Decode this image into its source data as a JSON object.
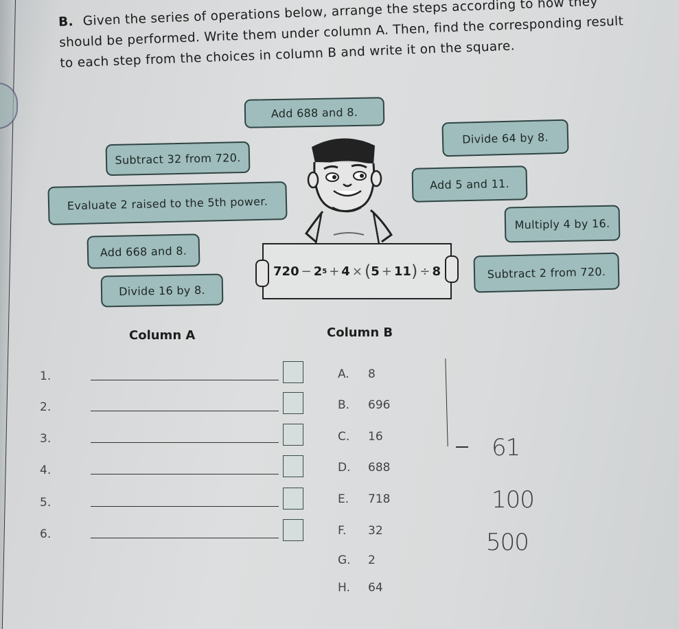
{
  "instructions": {
    "label": "B.",
    "text": "Given the series of operations below, arrange the steps according to how they should be performed. Write them under column A. Then, find the corresponding result to each step from the choices in column B and write it on the square."
  },
  "steps": [
    "Add 688 and 8.",
    "Subtract 32 from 720.",
    "Divide 64 by 8.",
    "Evaluate 2 raised to the 5th power.",
    "Add 5 and 11.",
    "Multiply 4 by 16.",
    "Add 668 and 8.",
    "Divide 16 by 8.",
    "Subtract 2 from 720."
  ],
  "expression": {
    "base1": "720",
    "minus": "−",
    "base2": "2",
    "exp": "5",
    "plus1": "+",
    "factor": "4",
    "times": "×",
    "open": "(",
    "a": "5",
    "plus2": "+",
    "b": "11",
    "close": ")",
    "div": "÷",
    "divisor": "8"
  },
  "column_a": {
    "title": "Column A",
    "rows": [
      "1.",
      "2.",
      "3.",
      "4.",
      "5.",
      "6."
    ]
  },
  "column_b": {
    "title": "Column B",
    "items": [
      {
        "letter": "A.",
        "value": "8"
      },
      {
        "letter": "B.",
        "value": "696"
      },
      {
        "letter": "C.",
        "value": "16"
      },
      {
        "letter": "D.",
        "value": "688"
      },
      {
        "letter": "E.",
        "value": "718"
      },
      {
        "letter": "F.",
        "value": "32"
      },
      {
        "letter": "G.",
        "value": "2"
      },
      {
        "letter": "H.",
        "value": "64"
      }
    ]
  },
  "handwriting": [
    "61",
    "100",
    "500"
  ],
  "colors": {
    "box_fill": "#9fbdbc",
    "box_border": "#2f4443",
    "paper": "#dcdedf"
  }
}
